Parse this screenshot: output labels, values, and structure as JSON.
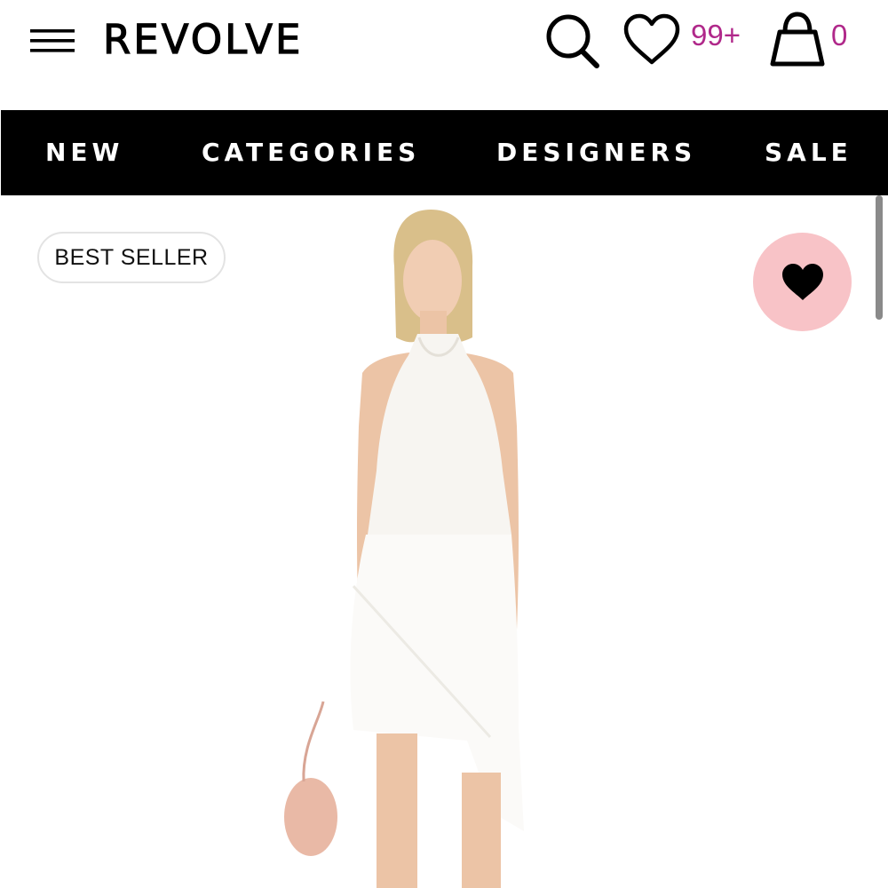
{
  "header": {
    "logo": "REVOLVE",
    "wishlist_count": "99+",
    "bag_count": "0",
    "icons": {
      "menu": "hamburger-menu-icon",
      "search": "search-icon",
      "wishlist": "heart-outline-icon",
      "bag": "shopping-bag-icon"
    },
    "count_color": "#b0288a"
  },
  "nav": {
    "items": [
      {
        "label": "NEW"
      },
      {
        "label": "CATEGORIES"
      },
      {
        "label": "DESIGNERS"
      },
      {
        "label": "SALE"
      }
    ],
    "background": "#000000",
    "text_color": "#ffffff"
  },
  "product": {
    "badge": "BEST SELLER",
    "favorite_icon": "heart-filled-icon",
    "favorite_button_color": "#f8c3c7",
    "image_description_icon": "model-photo"
  }
}
